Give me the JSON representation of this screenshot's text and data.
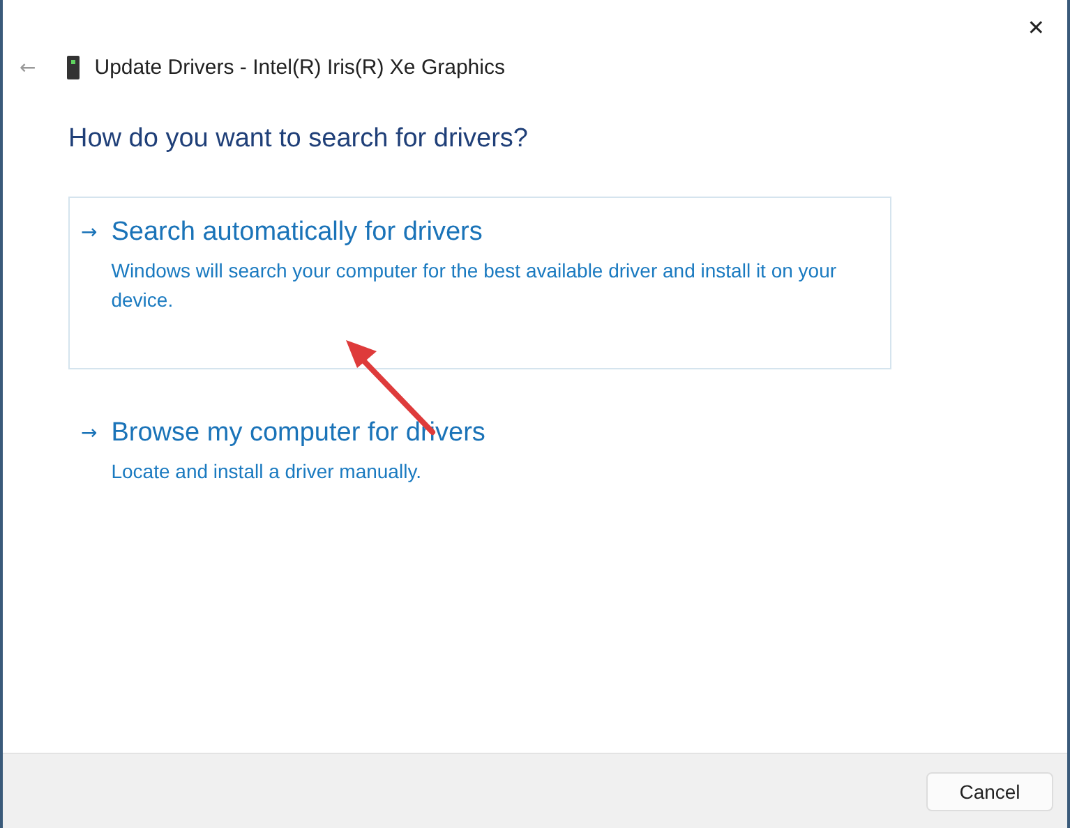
{
  "window": {
    "title": "Update Drivers - Intel(R) Iris(R) Xe Graphics",
    "close": "✕",
    "back": "←"
  },
  "heading": "How do you want to search for drivers?",
  "options": [
    {
      "arrow": "→",
      "title": "Search automatically for drivers",
      "description": "Windows will search your computer for the best available driver and install it on your device.",
      "highlighted": true
    },
    {
      "arrow": "→",
      "title": "Browse my computer for drivers",
      "description": "Locate and install a driver manually.",
      "highlighted": false
    }
  ],
  "buttons": [
    "Cancel"
  ]
}
